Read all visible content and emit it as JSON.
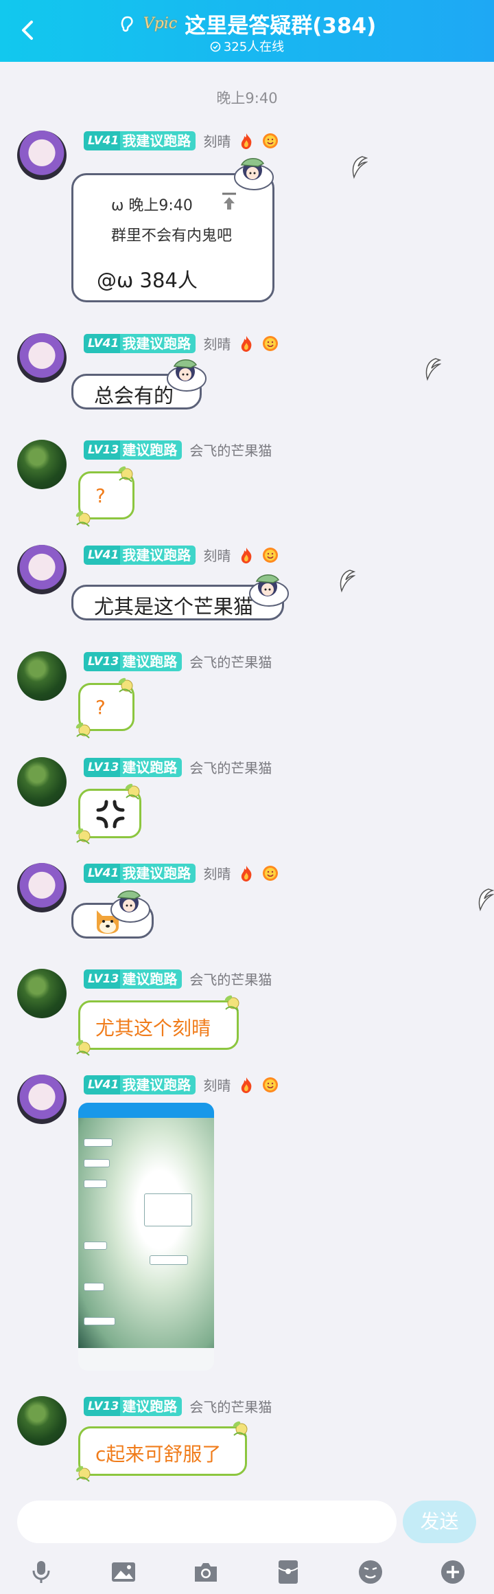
{
  "header": {
    "title": "这里是答疑群(384)",
    "online": "325人在线",
    "vip_badge": "Vpic",
    "bg_color": "#12c8ee"
  },
  "time_separator": "晚上9:40",
  "users": {
    "keqing": {
      "level": "LV41",
      "title": "我建议跑路",
      "name": "刻晴"
    },
    "mango": {
      "level": "LV13",
      "title": "建议跑路",
      "name": "会飞的芒果猫"
    }
  },
  "messages": [
    {
      "id": 1,
      "sender": "keqing",
      "type": "quote",
      "quote_name": "ω 晚上9:40",
      "quote_text": "群里不会有内鬼吧",
      "mention": "@ω 384人"
    },
    {
      "id": 2,
      "sender": "keqing",
      "type": "text",
      "text": "总会有的"
    },
    {
      "id": 3,
      "sender": "mango",
      "type": "text",
      "text": "?"
    },
    {
      "id": 4,
      "sender": "keqing",
      "type": "text",
      "text": "尤其是这个芒果猫"
    },
    {
      "id": 5,
      "sender": "mango",
      "type": "text",
      "text": "?"
    },
    {
      "id": 6,
      "sender": "mango",
      "type": "emoji",
      "emoji": "anger-symbol"
    },
    {
      "id": 7,
      "sender": "keqing",
      "type": "emoji",
      "emoji": "shiba-dog"
    },
    {
      "id": 8,
      "sender": "mango",
      "type": "text",
      "text": "尤其这个刻晴"
    },
    {
      "id": 9,
      "sender": "keqing",
      "type": "image",
      "image": "chat-screenshot"
    },
    {
      "id": 10,
      "sender": "mango",
      "type": "text",
      "text": "c起来可舒服了"
    }
  ],
  "input": {
    "placeholder": "",
    "send_label": "发送"
  },
  "toolbar": [
    "microphone-icon",
    "image-icon",
    "camera-icon",
    "red-packet-icon",
    "emoji-icon",
    "plus-icon"
  ]
}
